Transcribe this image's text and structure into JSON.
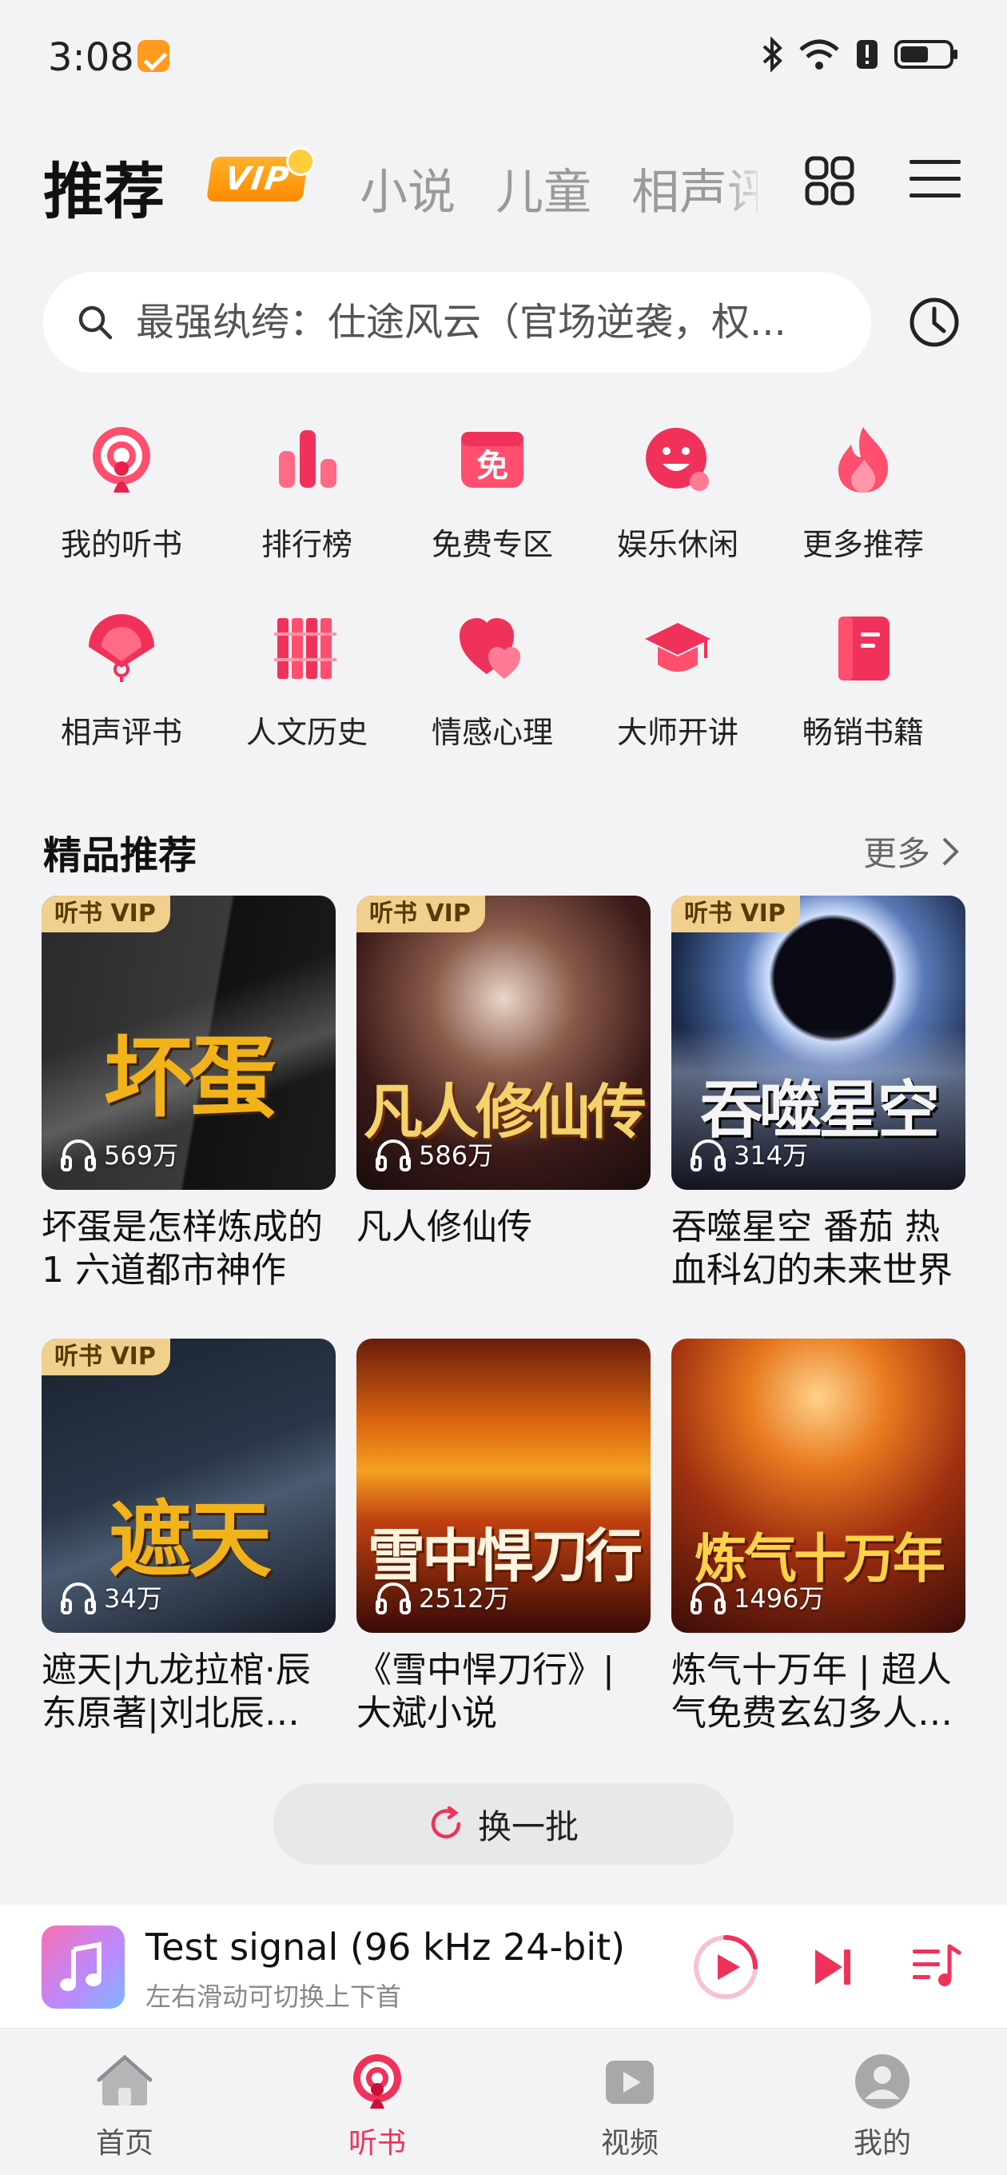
{
  "status_bar": {
    "time": "3:08"
  },
  "top_nav": {
    "active_tab": "推荐",
    "vip_label": "VIP",
    "tabs": [
      "小说",
      "儿童",
      "相声评书"
    ]
  },
  "search": {
    "placeholder": "最强纨绔：仕途风云（官场逆袭，权..."
  },
  "categories": [
    {
      "label": "我的听书",
      "icon": "podcast-icon"
    },
    {
      "label": "排行榜",
      "icon": "ranking-icon"
    },
    {
      "label": "免费专区",
      "icon": "free-icon",
      "glyph": "免"
    },
    {
      "label": "娱乐休闲",
      "icon": "smile-icon"
    },
    {
      "label": "更多推荐",
      "icon": "fire-icon"
    },
    {
      "label": "相声评书",
      "icon": "fan-icon"
    },
    {
      "label": "人文历史",
      "icon": "bamboo-scroll-icon"
    },
    {
      "label": "情感心理",
      "icon": "heart-icon"
    },
    {
      "label": "大师开讲",
      "icon": "graduation-cap-icon"
    },
    {
      "label": "畅销书籍",
      "icon": "book-icon"
    }
  ],
  "section": {
    "title": "精品推荐",
    "more_label": "更多"
  },
  "books": [
    {
      "title": "坏蛋是怎样炼成的1 六道都市神作",
      "plays": "569万",
      "vip": "听书 VIP",
      "cover_text": "坏蛋"
    },
    {
      "title": "凡人修仙传",
      "plays": "586万",
      "vip": "听书 VIP",
      "cover_text": "凡人修仙传"
    },
    {
      "title": "吞噬星空 番茄 热血科幻的未来世界",
      "plays": "314万",
      "vip": "听书 VIP",
      "cover_text": "吞噬星空"
    },
    {
      "title": "遮天|九龙拉棺·辰东原著|刘北辰…",
      "plays": "34万",
      "vip": "听书 VIP",
      "cover_text": "遮天"
    },
    {
      "title": "《雪中悍刀行》| 大斌小说",
      "plays": "2512万",
      "vip": "",
      "cover_text": "雪中悍刀行"
    },
    {
      "title": "炼气十万年 | 超人气免费玄幻多人…",
      "plays": "1496万",
      "vip": "",
      "cover_text": "炼气十万年"
    }
  ],
  "refresh": {
    "label": "换一批"
  },
  "player": {
    "title": "Test signal (96 kHz 24-bit)",
    "subtitle": "左右滑动可切换上下首"
  },
  "bottom_nav": [
    {
      "label": "首页",
      "icon": "home-icon",
      "active": false
    },
    {
      "label": "听书",
      "icon": "podcast-icon",
      "active": true
    },
    {
      "label": "视频",
      "icon": "video-icon",
      "active": false
    },
    {
      "label": "我的",
      "icon": "profile-icon",
      "active": false
    }
  ],
  "colors": {
    "accent": "#f0325a",
    "background": "#f3f3f5",
    "vip_gold": "#f1cf8c"
  }
}
